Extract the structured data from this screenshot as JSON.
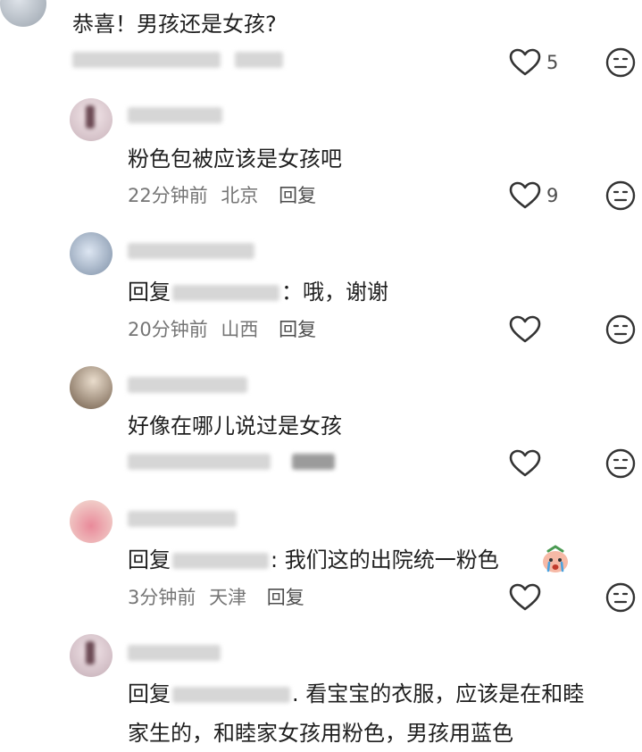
{
  "comments": [
    {
      "text": "恭喜！男孩还是女孩?",
      "likes": "5"
    },
    {
      "text": "粉色包被应该是女孩吧",
      "time": "22分钟前",
      "location": "北京",
      "reply": "回复",
      "likes": "9"
    },
    {
      "reply_prefix": "回复",
      "text": "：哦，谢谢",
      "time": "20分钟前",
      "location": "山西",
      "reply": "回复"
    },
    {
      "text": "好像在哪儿说过是女孩"
    },
    {
      "reply_prefix": "回复",
      "text": ": 我们这的出院统一粉色",
      "time": "3分钟前",
      "location": "天津",
      "reply": "回复"
    },
    {
      "reply_prefix": "回复",
      "text_line1": ". 看宝宝的衣服，应该是在和睦",
      "text_line2": "家生的，和睦家女孩用粉色，男孩用蓝色"
    }
  ],
  "icons": {
    "like": "heart-outline-icon",
    "dislike": "neutral-face-icon"
  },
  "colors": {
    "text": "#1f1f1f",
    "meta": "#757575",
    "icon": "#333333"
  }
}
